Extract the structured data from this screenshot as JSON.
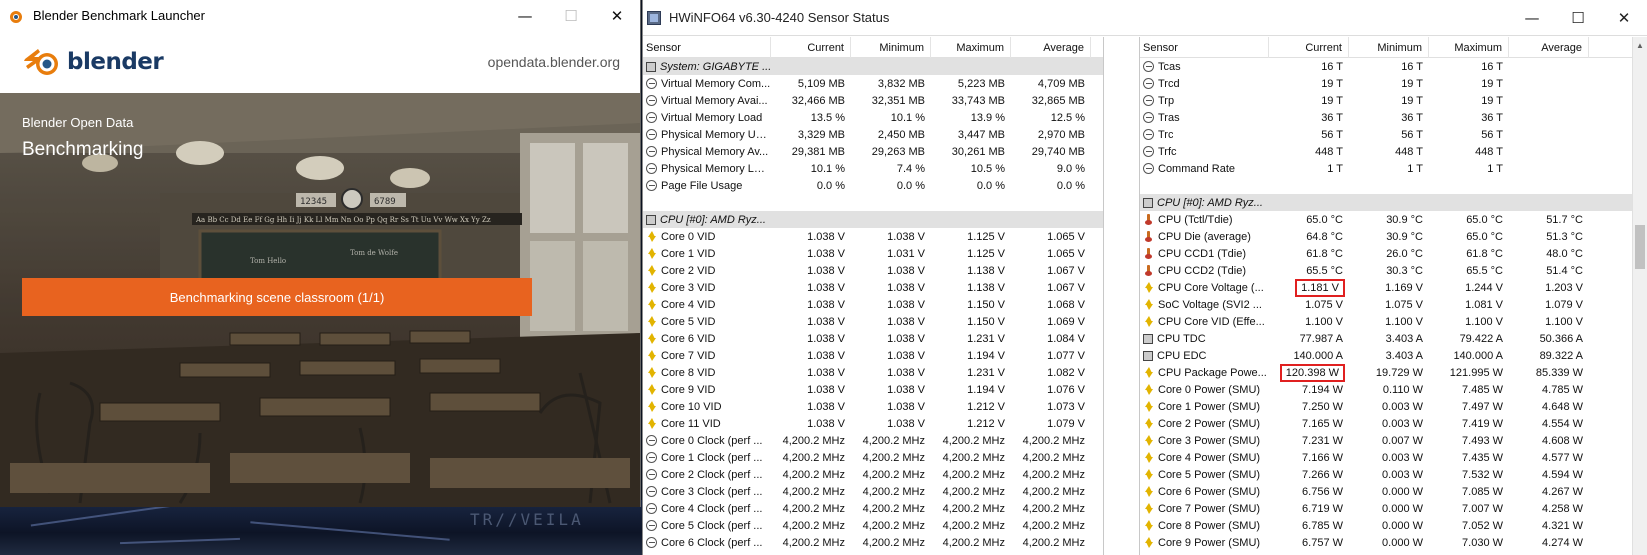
{
  "blender": {
    "window_title": "Blender Benchmark Launcher",
    "controls": {
      "minimize": "—",
      "maximize": "☐",
      "close": "✕"
    },
    "logo_text": "blender",
    "url": "opendata.blender.org",
    "hero_subtitle": "Blender Open Data",
    "hero_title": "Benchmarking",
    "progress_label": "Benchmarking scene classroom (1/1)",
    "scene_text": {
      "clock_left": "12345",
      "clock_right": "6789",
      "alphabet": "Aa Bb Cc Dd Ee Ff Gg Hh Ii Jj Kk Ll Mm Nn Oo Pp Qq Rr Ss Tt Uu Vv Ww Xx Yy Zz",
      "board_left": "Tom Hello",
      "board_right": "Tom de Wolfe"
    },
    "accent": "#e8631f"
  },
  "desktop": {
    "watermark": "TR//VEILA"
  },
  "hwinfo": {
    "window_title": "HWiNFO64 v6.30-4240 Sensor Status",
    "controls": {
      "minimize": "—",
      "maximize": "☐",
      "close": "✕"
    },
    "columns": [
      "Sensor",
      "Current",
      "Minimum",
      "Maximum",
      "Average"
    ],
    "left_rows": [
      {
        "type": "group",
        "label": "System: GIGABYTE ..."
      },
      {
        "icon": "clock",
        "label": "Virtual Memory Com...",
        "cur": "5,109 MB",
        "min": "3,832 MB",
        "max": "5,223 MB",
        "avg": "4,709 MB"
      },
      {
        "icon": "clock",
        "label": "Virtual Memory Avai...",
        "cur": "32,466 MB",
        "min": "32,351 MB",
        "max": "33,743 MB",
        "avg": "32,865 MB"
      },
      {
        "icon": "clock",
        "label": "Virtual Memory Load",
        "cur": "13.5 %",
        "min": "10.1 %",
        "max": "13.9 %",
        "avg": "12.5 %"
      },
      {
        "icon": "clock",
        "label": "Physical Memory Used",
        "cur": "3,329 MB",
        "min": "2,450 MB",
        "max": "3,447 MB",
        "avg": "2,970 MB"
      },
      {
        "icon": "clock",
        "label": "Physical Memory Av...",
        "cur": "29,381 MB",
        "min": "29,263 MB",
        "max": "30,261 MB",
        "avg": "29,740 MB"
      },
      {
        "icon": "clock",
        "label": "Physical Memory Load",
        "cur": "10.1 %",
        "min": "7.4 %",
        "max": "10.5 %",
        "avg": "9.0 %"
      },
      {
        "icon": "clock",
        "label": "Page File Usage",
        "cur": "0.0 %",
        "min": "0.0 %",
        "max": "0.0 %",
        "avg": "0.0 %"
      },
      {
        "type": "blank"
      },
      {
        "type": "group",
        "label": "CPU [#0]: AMD Ryz..."
      },
      {
        "icon": "bolt",
        "label": "Core 0 VID",
        "cur": "1.038 V",
        "min": "1.038 V",
        "max": "1.125 V",
        "avg": "1.065 V"
      },
      {
        "icon": "bolt",
        "label": "Core 1 VID",
        "cur": "1.038 V",
        "min": "1.031 V",
        "max": "1.125 V",
        "avg": "1.065 V"
      },
      {
        "icon": "bolt",
        "label": "Core 2 VID",
        "cur": "1.038 V",
        "min": "1.038 V",
        "max": "1.138 V",
        "avg": "1.067 V"
      },
      {
        "icon": "bolt",
        "label": "Core 3 VID",
        "cur": "1.038 V",
        "min": "1.038 V",
        "max": "1.138 V",
        "avg": "1.067 V"
      },
      {
        "icon": "bolt",
        "label": "Core 4 VID",
        "cur": "1.038 V",
        "min": "1.038 V",
        "max": "1.150 V",
        "avg": "1.068 V"
      },
      {
        "icon": "bolt",
        "label": "Core 5 VID",
        "cur": "1.038 V",
        "min": "1.038 V",
        "max": "1.150 V",
        "avg": "1.069 V"
      },
      {
        "icon": "bolt",
        "label": "Core 6 VID",
        "cur": "1.038 V",
        "min": "1.038 V",
        "max": "1.231 V",
        "avg": "1.084 V"
      },
      {
        "icon": "bolt",
        "label": "Core 7 VID",
        "cur": "1.038 V",
        "min": "1.038 V",
        "max": "1.194 V",
        "avg": "1.077 V"
      },
      {
        "icon": "bolt",
        "label": "Core 8 VID",
        "cur": "1.038 V",
        "min": "1.038 V",
        "max": "1.231 V",
        "avg": "1.082 V"
      },
      {
        "icon": "bolt",
        "label": "Core 9 VID",
        "cur": "1.038 V",
        "min": "1.038 V",
        "max": "1.194 V",
        "avg": "1.076 V"
      },
      {
        "icon": "bolt",
        "label": "Core 10 VID",
        "cur": "1.038 V",
        "min": "1.038 V",
        "max": "1.212 V",
        "avg": "1.073 V"
      },
      {
        "icon": "bolt",
        "label": "Core 11 VID",
        "cur": "1.038 V",
        "min": "1.038 V",
        "max": "1.212 V",
        "avg": "1.079 V"
      },
      {
        "icon": "clock",
        "label": "Core 0 Clock (perf ...",
        "cur": "4,200.2 MHz",
        "min": "4,200.2 MHz",
        "max": "4,200.2 MHz",
        "avg": "4,200.2 MHz"
      },
      {
        "icon": "clock",
        "label": "Core 1 Clock (perf ...",
        "cur": "4,200.2 MHz",
        "min": "4,200.2 MHz",
        "max": "4,200.2 MHz",
        "avg": "4,200.2 MHz"
      },
      {
        "icon": "clock",
        "label": "Core 2 Clock (perf ...",
        "cur": "4,200.2 MHz",
        "min": "4,200.2 MHz",
        "max": "4,200.2 MHz",
        "avg": "4,200.2 MHz"
      },
      {
        "icon": "clock",
        "label": "Core 3 Clock (perf ...",
        "cur": "4,200.2 MHz",
        "min": "4,200.2 MHz",
        "max": "4,200.2 MHz",
        "avg": "4,200.2 MHz"
      },
      {
        "icon": "clock",
        "label": "Core 4 Clock (perf ...",
        "cur": "4,200.2 MHz",
        "min": "4,200.2 MHz",
        "max": "4,200.2 MHz",
        "avg": "4,200.2 MHz"
      },
      {
        "icon": "clock",
        "label": "Core 5 Clock (perf ...",
        "cur": "4,200.2 MHz",
        "min": "4,200.2 MHz",
        "max": "4,200.2 MHz",
        "avg": "4,200.2 MHz"
      },
      {
        "icon": "clock",
        "label": "Core 6 Clock (perf ...",
        "cur": "4,200.2 MHz",
        "min": "4,200.2 MHz",
        "max": "4,200.2 MHz",
        "avg": "4,200.2 MHz"
      }
    ],
    "right_rows": [
      {
        "icon": "clock",
        "label": "Tcas",
        "cur": "16 T",
        "min": "16 T",
        "max": "16 T",
        "avg": ""
      },
      {
        "icon": "clock",
        "label": "Trcd",
        "cur": "19 T",
        "min": "19 T",
        "max": "19 T",
        "avg": ""
      },
      {
        "icon": "clock",
        "label": "Trp",
        "cur": "19 T",
        "min": "19 T",
        "max": "19 T",
        "avg": ""
      },
      {
        "icon": "clock",
        "label": "Tras",
        "cur": "36 T",
        "min": "36 T",
        "max": "36 T",
        "avg": ""
      },
      {
        "icon": "clock",
        "label": "Trc",
        "cur": "56 T",
        "min": "56 T",
        "max": "56 T",
        "avg": ""
      },
      {
        "icon": "clock",
        "label": "Trfc",
        "cur": "448 T",
        "min": "448 T",
        "max": "448 T",
        "avg": ""
      },
      {
        "icon": "clock",
        "label": "Command Rate",
        "cur": "1 T",
        "min": "1 T",
        "max": "1 T",
        "avg": ""
      },
      {
        "type": "blank"
      },
      {
        "type": "group",
        "label": "CPU [#0]: AMD Ryz..."
      },
      {
        "icon": "therm",
        "label": "CPU (Tctl/Tdie)",
        "cur": "65.0 °C",
        "min": "30.9 °C",
        "max": "65.0 °C",
        "avg": "51.7 °C"
      },
      {
        "icon": "therm",
        "label": "CPU Die (average)",
        "cur": "64.8 °C",
        "min": "30.9 °C",
        "max": "65.0 °C",
        "avg": "51.3 °C"
      },
      {
        "icon": "therm",
        "label": "CPU CCD1 (Tdie)",
        "cur": "61.8 °C",
        "min": "26.0 °C",
        "max": "61.8 °C",
        "avg": "48.0 °C"
      },
      {
        "icon": "therm",
        "label": "CPU CCD2 (Tdie)",
        "cur": "65.5 °C",
        "min": "30.3 °C",
        "max": "65.5 °C",
        "avg": "51.4 °C"
      },
      {
        "icon": "bolt",
        "label": "CPU Core Voltage (...",
        "cur": "1.181 V",
        "min": "1.169 V",
        "max": "1.244 V",
        "avg": "1.203 V",
        "highlight": true
      },
      {
        "icon": "bolt",
        "label": "SoC Voltage (SVI2 ...",
        "cur": "1.075 V",
        "min": "1.075 V",
        "max": "1.081 V",
        "avg": "1.079 V"
      },
      {
        "icon": "bolt",
        "label": "CPU Core VID (Effe...",
        "cur": "1.100 V",
        "min": "1.100 V",
        "max": "1.100 V",
        "avg": "1.100 V"
      },
      {
        "icon": "chip",
        "label": "CPU TDC",
        "cur": "77.987 A",
        "min": "3.403 A",
        "max": "79.422 A",
        "avg": "50.366 A"
      },
      {
        "icon": "chip",
        "label": "CPU EDC",
        "cur": "140.000 A",
        "min": "3.403 A",
        "max": "140.000 A",
        "avg": "89.322 A"
      },
      {
        "icon": "bolt",
        "label": "CPU Package Powe...",
        "cur": "120.398 W",
        "min": "19.729 W",
        "max": "121.995 W",
        "avg": "85.339 W",
        "highlight": true
      },
      {
        "icon": "bolt",
        "label": "Core 0 Power (SMU)",
        "cur": "7.194 W",
        "min": "0.110 W",
        "max": "7.485 W",
        "avg": "4.785 W"
      },
      {
        "icon": "bolt",
        "label": "Core 1 Power (SMU)",
        "cur": "7.250 W",
        "min": "0.003 W",
        "max": "7.497 W",
        "avg": "4.648 W"
      },
      {
        "icon": "bolt",
        "label": "Core 2 Power (SMU)",
        "cur": "7.165 W",
        "min": "0.003 W",
        "max": "7.419 W",
        "avg": "4.554 W"
      },
      {
        "icon": "bolt",
        "label": "Core 3 Power (SMU)",
        "cur": "7.231 W",
        "min": "0.007 W",
        "max": "7.493 W",
        "avg": "4.608 W"
      },
      {
        "icon": "bolt",
        "label": "Core 4 Power (SMU)",
        "cur": "7.166 W",
        "min": "0.003 W",
        "max": "7.435 W",
        "avg": "4.577 W"
      },
      {
        "icon": "bolt",
        "label": "Core 5 Power (SMU)",
        "cur": "7.266 W",
        "min": "0.003 W",
        "max": "7.532 W",
        "avg": "4.594 W"
      },
      {
        "icon": "bolt",
        "label": "Core 6 Power (SMU)",
        "cur": "6.756 W",
        "min": "0.000 W",
        "max": "7.085 W",
        "avg": "4.267 W"
      },
      {
        "icon": "bolt",
        "label": "Core 7 Power (SMU)",
        "cur": "6.719 W",
        "min": "0.000 W",
        "max": "7.007 W",
        "avg": "4.258 W"
      },
      {
        "icon": "bolt",
        "label": "Core 8 Power (SMU)",
        "cur": "6.785 W",
        "min": "0.000 W",
        "max": "7.052 W",
        "avg": "4.321 W"
      },
      {
        "icon": "bolt",
        "label": "Core 9 Power (SMU)",
        "cur": "6.757 W",
        "min": "0.000 W",
        "max": "7.030 W",
        "avg": "4.274 W"
      }
    ],
    "highlight_color": "#e02020",
    "group_bg": "#e1e1e1"
  }
}
